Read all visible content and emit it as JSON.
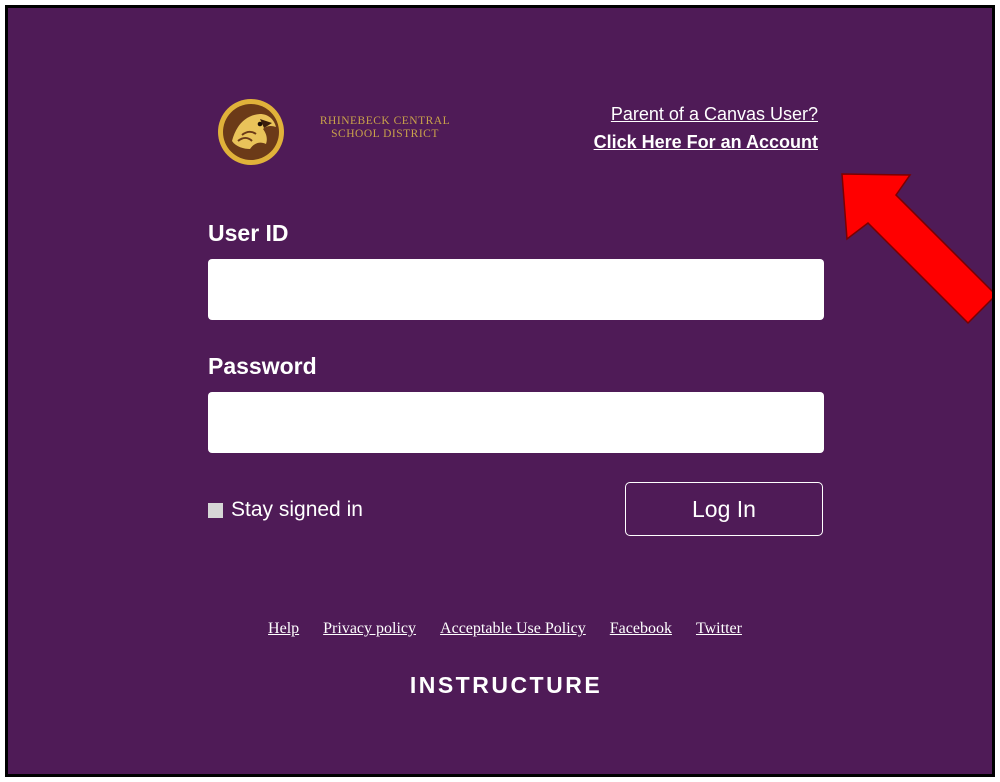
{
  "colors": {
    "background": "#4f1b57",
    "logo_gold": "#c9a24b",
    "arrow": "#ff0000",
    "text": "#ffffff"
  },
  "logo": {
    "line1": "RHINEBECK CENTRAL",
    "line2": "SCHOOL DISTRICT",
    "icon": "hawk-emblem-icon"
  },
  "parent_link": {
    "question": "Parent of a Canvas User?",
    "action": "Click Here For an Account"
  },
  "form": {
    "userid_label": "User ID",
    "userid_value": "",
    "password_label": "Password",
    "password_value": "",
    "stay_signed_in_label": "Stay signed in",
    "stay_signed_in_checked": false,
    "login_button": "Log In"
  },
  "footer": {
    "links": [
      "Help",
      "Privacy policy",
      "Acceptable Use Policy",
      "Facebook",
      "Twitter"
    ],
    "wordmark": "INSTRUCTURE"
  },
  "annotation": {
    "icon": "red-arrow-icon"
  }
}
